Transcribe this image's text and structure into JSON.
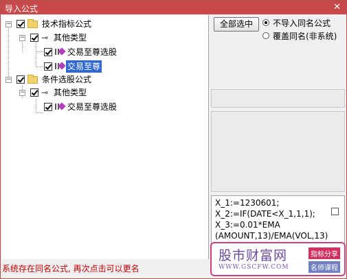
{
  "window": {
    "title": "导入公式",
    "close": "✕"
  },
  "tree": {
    "groups": [
      {
        "label": "技术指标公式",
        "type_label": "其他类型",
        "items": [
          "交易至尊选股",
          "交易至尊"
        ]
      },
      {
        "label": "条件选股公式",
        "type_label": "其他类型",
        "items": [
          "交易至尊选股"
        ]
      }
    ],
    "selected_item": "交易至尊"
  },
  "right": {
    "select_all_label": "全部选中",
    "radio_options": [
      {
        "label": "不导入同名公式",
        "checked": true
      },
      {
        "label": "覆盖同名(非系统)",
        "checked": false
      }
    ],
    "code_lines": [
      "X_1:=1230601;",
      "X_2:=IF(DATE<X_1,1,1);",
      "X_3:=0.01*EMA",
      "(AMOUNT,13)/EMA(VOL,13)"
    ]
  },
  "status": "系统存在同名公式, 再次点击可以更名",
  "watermark": {
    "brand": "股市财富网",
    "url": "WWW.GSCFW.COM",
    "tag1": "指标分享",
    "tag2": "名师课程"
  },
  "colors": {
    "titlebar": "#c8494a",
    "selection": "#3068d0",
    "status_text": "#c00000"
  }
}
